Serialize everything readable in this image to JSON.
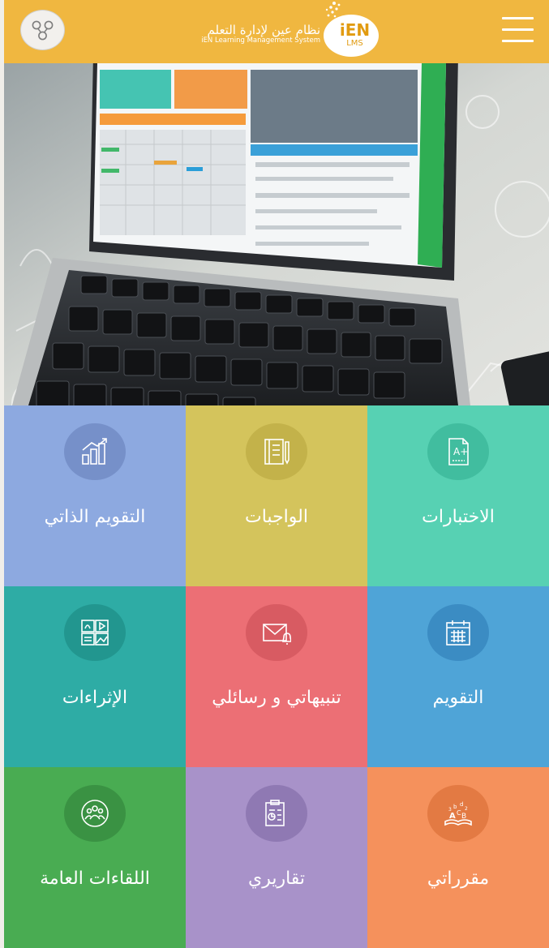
{
  "header": {
    "logo_main": "iEN",
    "logo_sub": "LMS",
    "brand_ar": "نظام عين لإدارة التعلم",
    "brand_en": "iEN Learning Management System",
    "bg_color": "#f0b740",
    "share_icon": "share-icon",
    "menu_icon": "hamburger-menu-icon"
  },
  "hero": {
    "alt": "laptop-showing-ien-lms-dashboard"
  },
  "tiles": [
    {
      "label": "التقويم الذاتي",
      "icon": "self-assessment-chart-icon",
      "color": "#8da9e0"
    },
    {
      "label": "الواجبات",
      "icon": "assignments-notebook-icon",
      "color": "#d4c45c"
    },
    {
      "label": "الاختبارات",
      "icon": "exams-document-icon",
      "color": "#57d1b3"
    },
    {
      "label": "الإثراءات",
      "icon": "enrichment-media-icon",
      "color": "#2eaca5"
    },
    {
      "label": "تنبيهاتي و رسائلي",
      "icon": "messages-envelope-icon",
      "color": "#ec6f75"
    },
    {
      "label": "التقويم",
      "icon": "calendar-icon",
      "color": "#4fa4d7"
    },
    {
      "label": "اللقاءات العامة",
      "icon": "meetings-people-icon",
      "color": "#49ac52"
    },
    {
      "label": "تقاريري",
      "icon": "reports-clipboard-icon",
      "color": "#a892c9"
    },
    {
      "label": "مقرراتي",
      "icon": "courses-book-icon",
      "color": "#f5915c"
    }
  ]
}
